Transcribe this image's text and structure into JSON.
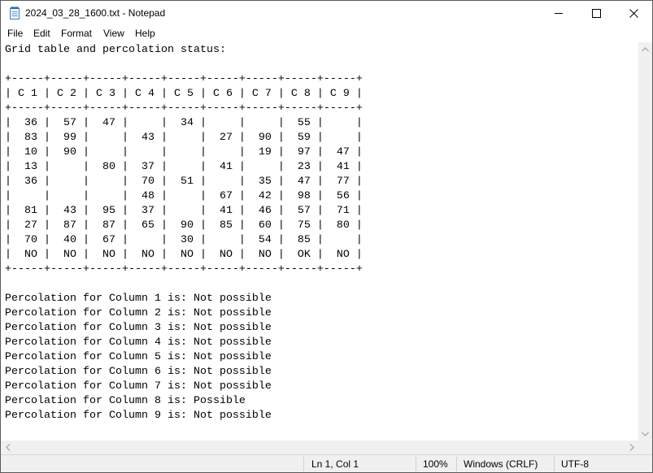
{
  "window": {
    "title": "2024_03_28_1600.txt - Notepad"
  },
  "menu": [
    "File",
    "Edit",
    "Format",
    "View",
    "Help"
  ],
  "document": {
    "content": "Grid table and percolation status:\n\n+-----+-----+-----+-----+-----+-----+-----+-----+-----+\n| C 1 | C 2 | C 3 | C 4 | C 5 | C 6 | C 7 | C 8 | C 9 |\n+-----+-----+-----+-----+-----+-----+-----+-----+-----+\n|  36 |  57 |  47 |     |  34 |     |     |  55 |     |\n|  83 |  99 |     |  43 |     |  27 |  90 |  59 |     |\n|  10 |  90 |     |     |     |     |  19 |  97 |  47 |\n|  13 |     |  80 |  37 |     |  41 |     |  23 |  41 |\n|  36 |     |     |  70 |  51 |     |  35 |  47 |  77 |\n|     |     |     |  48 |     |  67 |  42 |  98 |  56 |\n|  81 |  43 |  95 |  37 |     |  41 |  46 |  57 |  71 |\n|  27 |  87 |  87 |  65 |  90 |  85 |  60 |  75 |  80 |\n|  70 |  40 |  67 |     |  30 |     |  54 |  85 |     |\n|  NO |  NO |  NO |  NO |  NO |  NO |  NO |  OK |  NO |\n+-----+-----+-----+-----+-----+-----+-----+-----+-----+\n\nPercolation for Column 1 is: Not possible\nPercolation for Column 2 is: Not possible\nPercolation for Column 3 is: Not possible\nPercolation for Column 4 is: Not possible\nPercolation for Column 5 is: Not possible\nPercolation for Column 6 is: Not possible\nPercolation for Column 7 is: Not possible\nPercolation for Column 8 is: Possible\nPercolation for Column 9 is: Not possible"
  },
  "status": {
    "position": "Ln 1, Col 1",
    "zoom": "100%",
    "line_ending": "Windows (CRLF)",
    "encoding": "UTF-8"
  },
  "icons": {
    "app": "notepad-icon",
    "minimize": "minimize-icon",
    "maximize": "maximize-icon",
    "close": "close-icon"
  }
}
